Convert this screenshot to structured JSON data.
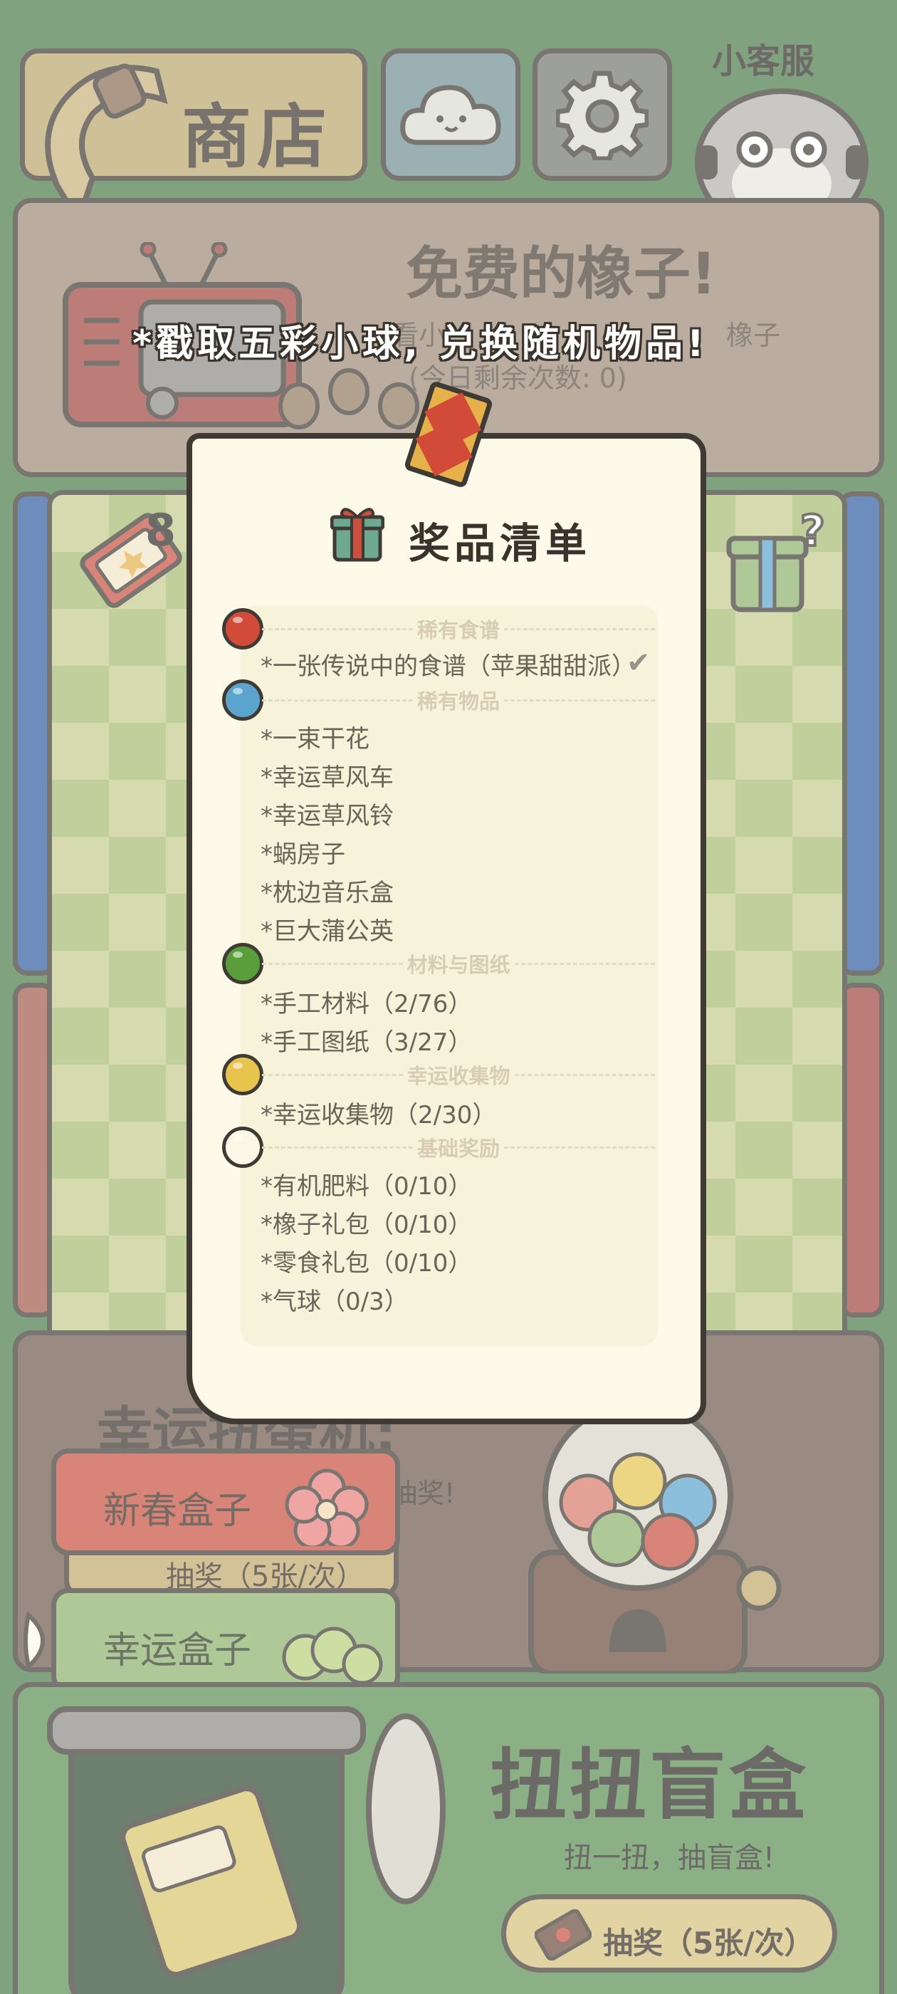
{
  "header": {
    "shop_label": "商店",
    "customer_service_label": "小客服"
  },
  "acorn_banner": {
    "title": "免费的橡子!",
    "subtitle": "看小",
    "subtitle_tail": "橡子",
    "remaining": "(今日剩余次数: 0)"
  },
  "hint": "*戳取五彩小球, 兑换随机物品!",
  "ticket_count": "8",
  "prize_list": {
    "title": "奖品清单",
    "sections": [
      {
        "label": "稀有食谱",
        "ball_color": "#d24a38",
        "items": [
          "*一张传说中的食谱（苹果甜甜派）"
        ]
      },
      {
        "label": "稀有物品",
        "ball_color": "#5aa4cd",
        "items": [
          "*一束干花",
          "*幸运草风车",
          "*幸运草风铃",
          "*蜗房子",
          "*枕边音乐盒",
          "*巨大蒲公英"
        ]
      },
      {
        "label": "材料与图纸",
        "ball_color": "#5a9e3c",
        "items": [
          "*手工材料（2/76）",
          "*手工图纸（3/27）"
        ]
      },
      {
        "label": "幸运收集物",
        "ball_color": "#e6c44e",
        "items": [
          "*幸运收集物（2/30）"
        ]
      },
      {
        "label": "基础奖励",
        "ball_color": "#fbf7e6",
        "items": [
          "*有机肥料（0/10）",
          "*橡子礼包（0/10）",
          "*零食礼包（0/10）",
          "*气球（0/3）"
        ]
      }
    ]
  },
  "gacha": {
    "title": "幸运扭蛋机:",
    "subtitle": "春抽奖!",
    "tabs": {
      "new_year": "新春盒子",
      "draw": "抽奖（5张/次）",
      "lucky": "幸运盒子"
    }
  },
  "blind_box": {
    "title": "扭扭盲盒",
    "subtitle": "扭一扭，抽盲盒!",
    "button": "抽奖（5张/次）"
  }
}
